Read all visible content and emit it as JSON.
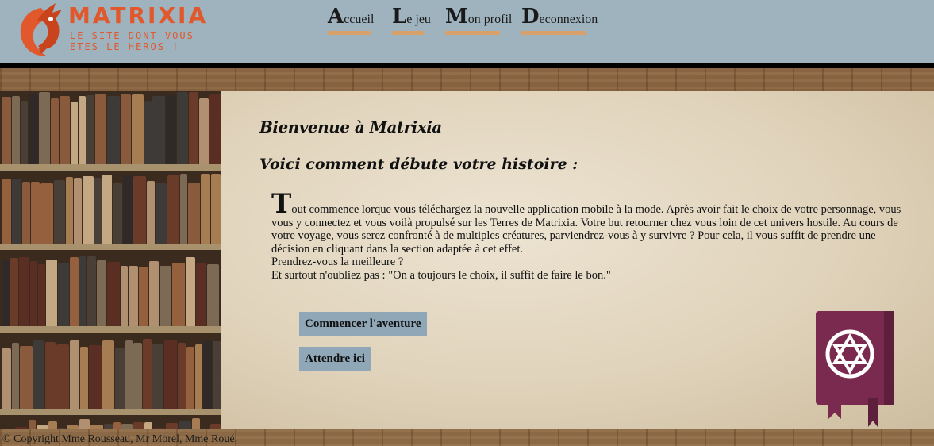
{
  "brand": {
    "name": "MATRIXIA",
    "tagline": "LE SITE DONT VOUS ETES LE HEROS !",
    "accent_color": "#e0582b"
  },
  "nav": {
    "items": [
      {
        "label": "Accueil"
      },
      {
        "label": "Le jeu"
      },
      {
        "label": "Mon profil"
      },
      {
        "label": "Deconnexion"
      }
    ],
    "underline_color": "#d9a06a"
  },
  "main": {
    "title": "Bienvenue à Matrixia",
    "subtitle": "Voici comment débute votre histoire :",
    "story_dropcap": "T",
    "story_paragraph": "out commence lorque vous téléchargez la nouvelle application mobile à la mode. Après avoir fait le choix de votre personnage, vous vous y connectez et vous voilà propulsé sur les Terres de Matrixia. Votre but retourner chez vous loin de cet univers hostile. Au cours de votre voyage, vous serez confronté à de multiples créatures, parviendrez-vous à y survivre ? Pour cela, il vous suffit de prendre une décision en cliquant dans la section adaptée à cet effet.",
    "story_line2": "Prendrez-vous la meilleure ?",
    "story_line3": "Et surtout n'oubliez pas : \"On a toujours le choix, il suffit de faire le bon.\"",
    "buttons": {
      "start": "Commencer l'aventure",
      "wait": "Attendre ici"
    },
    "button_color": "#8fa7b6",
    "book_icon": "spellbook-icon"
  },
  "footer": {
    "copyright": "© Copyright Mme Rousseau, Mr Morel, Mme Roué."
  }
}
